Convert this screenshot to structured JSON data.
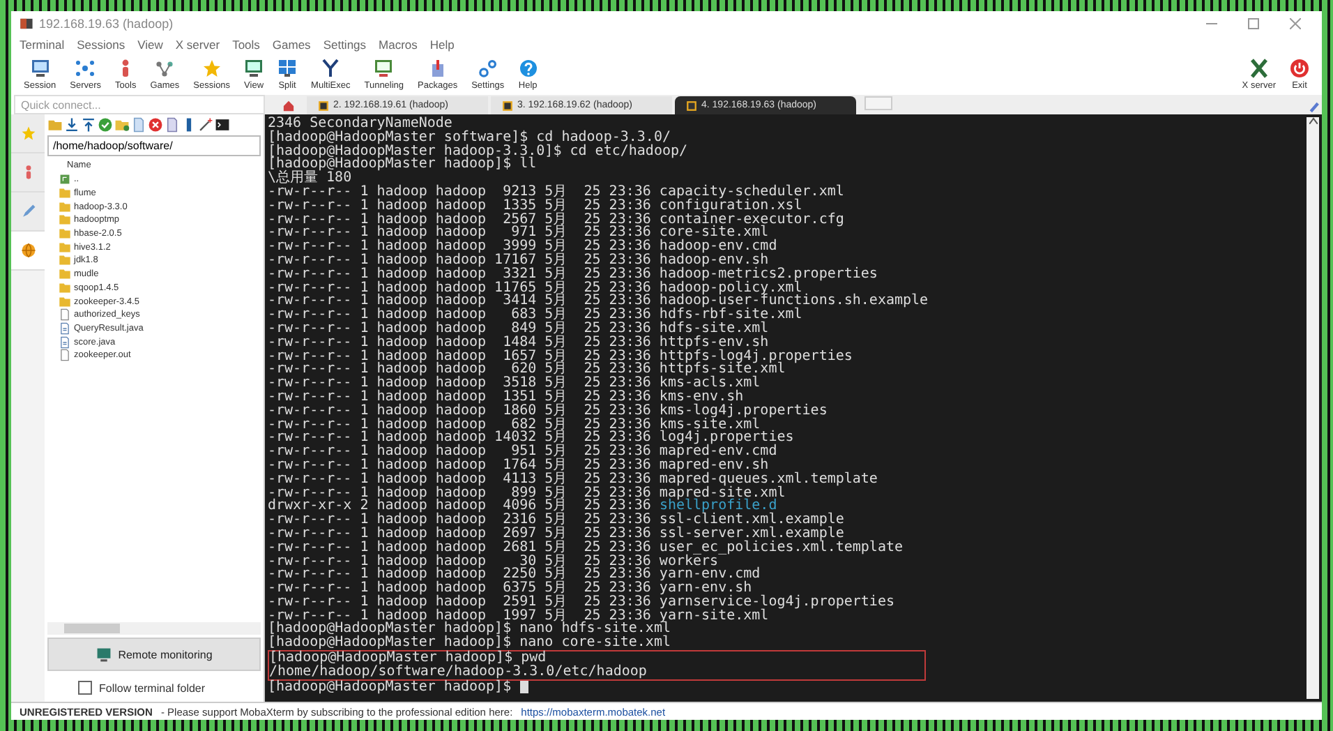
{
  "window": {
    "title": "192.168.19.63 (hadoop)"
  },
  "menu": [
    "Terminal",
    "Sessions",
    "View",
    "X server",
    "Tools",
    "Games",
    "Settings",
    "Macros",
    "Help"
  ],
  "toolbar": [
    "Session",
    "Servers",
    "Tools",
    "Games",
    "Sessions",
    "View",
    "Split",
    "MultiExec",
    "Tunneling",
    "Packages",
    "Settings",
    "Help"
  ],
  "toolbar_right": [
    "X server",
    "Exit"
  ],
  "quick_connect": {
    "placeholder": "Quick connect..."
  },
  "tabs": [
    {
      "label": "2. 192.168.19.61 (hadoop)",
      "selected": false
    },
    {
      "label": "3. 192.168.19.62 (hadoop)",
      "selected": false
    },
    {
      "label": "4. 192.168.19.63 (hadoop)",
      "selected": true
    }
  ],
  "side_tabs": [
    {
      "selected": false
    },
    {
      "selected": false
    },
    {
      "selected": false
    },
    {
      "selected": true
    }
  ],
  "sftp": {
    "path": "/home/hadoop/software/",
    "column": "Name",
    "items": [
      {
        "name": "..",
        "kind": "parent"
      },
      {
        "name": "flume",
        "kind": "folder"
      },
      {
        "name": "hadoop-3.3.0",
        "kind": "folder"
      },
      {
        "name": "hadooptmp",
        "kind": "folder"
      },
      {
        "name": "hbase-2.0.5",
        "kind": "folder"
      },
      {
        "name": "hive3.1.2",
        "kind": "folder"
      },
      {
        "name": "jdk1.8",
        "kind": "folder"
      },
      {
        "name": "mudle",
        "kind": "folder"
      },
      {
        "name": "sqoop1.4.5",
        "kind": "folder"
      },
      {
        "name": "zookeeper-3.4.5",
        "kind": "folder"
      },
      {
        "name": "authorized_keys",
        "kind": "file"
      },
      {
        "name": "QueryResult.java",
        "kind": "java"
      },
      {
        "name": "score.java",
        "kind": "java"
      },
      {
        "name": "zookeeper.out",
        "kind": "file"
      }
    ],
    "remote_monitoring": "Remote monitoring",
    "follow": {
      "label": "Follow terminal folder",
      "checked": false
    }
  },
  "terminal": {
    "lines": [
      {
        "text": "2346 SecondaryNameNode"
      },
      {
        "text": "[hadoop@HadoopMaster software]$ cd hadoop-3.3.0/"
      },
      {
        "text": "[hadoop@HadoopMaster hadoop-3.3.0]$ cd etc/hadoop/"
      },
      {
        "text": "[hadoop@HadoopMaster hadoop]$ ll"
      },
      {
        "text": "\\总用量 180"
      },
      {
        "text": "-rw-r--r-- 1 hadoop hadoop  9213 5月  25 23:36 capacity-scheduler.xml"
      },
      {
        "text": "-rw-r--r-- 1 hadoop hadoop  1335 5月  25 23:36 configuration.xsl"
      },
      {
        "text": "-rw-r--r-- 1 hadoop hadoop  2567 5月  25 23:36 container-executor.cfg"
      },
      {
        "text": "-rw-r--r-- 1 hadoop hadoop   971 5月  25 23:36 core-site.xml"
      },
      {
        "text": "-rw-r--r-- 1 hadoop hadoop  3999 5月  25 23:36 hadoop-env.cmd"
      },
      {
        "text": "-rw-r--r-- 1 hadoop hadoop 17167 5月  25 23:36 hadoop-env.sh"
      },
      {
        "text": "-rw-r--r-- 1 hadoop hadoop  3321 5月  25 23:36 hadoop-metrics2.properties"
      },
      {
        "text": "-rw-r--r-- 1 hadoop hadoop 11765 5月  25 23:36 hadoop-policy.xml"
      },
      {
        "text": "-rw-r--r-- 1 hadoop hadoop  3414 5月  25 23:36 hadoop-user-functions.sh.example"
      },
      {
        "text": "-rw-r--r-- 1 hadoop hadoop   683 5月  25 23:36 hdfs-rbf-site.xml"
      },
      {
        "text": "-rw-r--r-- 1 hadoop hadoop   849 5月  25 23:36 hdfs-site.xml"
      },
      {
        "text": "-rw-r--r-- 1 hadoop hadoop  1484 5月  25 23:36 httpfs-env.sh"
      },
      {
        "text": "-rw-r--r-- 1 hadoop hadoop  1657 5月  25 23:36 httpfs-log4j.properties"
      },
      {
        "text": "-rw-r--r-- 1 hadoop hadoop   620 5月  25 23:36 httpfs-site.xml"
      },
      {
        "text": "-rw-r--r-- 1 hadoop hadoop  3518 5月  25 23:36 kms-acls.xml"
      },
      {
        "text": "-rw-r--r-- 1 hadoop hadoop  1351 5月  25 23:36 kms-env.sh"
      },
      {
        "text": "-rw-r--r-- 1 hadoop hadoop  1860 5月  25 23:36 kms-log4j.properties"
      },
      {
        "text": "-rw-r--r-- 1 hadoop hadoop   682 5月  25 23:36 kms-site.xml"
      },
      {
        "text": "-rw-r--r-- 1 hadoop hadoop 14032 5月  25 23:36 log4j.properties"
      },
      {
        "text": "-rw-r--r-- 1 hadoop hadoop   951 5月  25 23:36 mapred-env.cmd"
      },
      {
        "text": "-rw-r--r-- 1 hadoop hadoop  1764 5月  25 23:36 mapred-env.sh"
      },
      {
        "text": "-rw-r--r-- 1 hadoop hadoop  4113 5月  25 23:36 mapred-queues.xml.template"
      },
      {
        "text": "-rw-r--r-- 1 hadoop hadoop   899 5月  25 23:36 mapred-site.xml"
      },
      {
        "text": "drwxr-xr-x 2 hadoop hadoop  4096 5月  25 23:36 ",
        "dir": "shellprofile.d"
      },
      {
        "text": "-rw-r--r-- 1 hadoop hadoop  2316 5月  25 23:36 ssl-client.xml.example"
      },
      {
        "text": "-rw-r--r-- 1 hadoop hadoop  2697 5月  25 23:36 ssl-server.xml.example"
      },
      {
        "text": "-rw-r--r-- 1 hadoop hadoop  2681 5月  25 23:36 user_ec_policies.xml.template"
      },
      {
        "text": "-rw-r--r-- 1 hadoop hadoop    30 5月  25 23:36 workers"
      },
      {
        "text": "-rw-r--r-- 1 hadoop hadoop  2250 5月  25 23:36 yarn-env.cmd"
      },
      {
        "text": "-rw-r--r-- 1 hadoop hadoop  6375 5月  25 23:36 yarn-env.sh"
      },
      {
        "text": "-rw-r--r-- 1 hadoop hadoop  2591 5月  25 23:36 yarnservice-log4j.properties"
      },
      {
        "text": "-rw-r--r-- 1 hadoop hadoop  1997 5月  25 23:36 yarn-site.xml"
      },
      {
        "text": "[hadoop@HadoopMaster hadoop]$ nano hdfs-site.xml"
      },
      {
        "text": "[hadoop@HadoopMaster hadoop]$ nano core-site.xml"
      }
    ],
    "highlighted_lines": [
      {
        "text": "[hadoop@HadoopMaster hadoop]$ pwd"
      },
      {
        "text": "/home/hadoop/software/hadoop-3.3.0/etc/hadoop"
      }
    ],
    "prompt": {
      "text": "[hadoop@HadoopMaster hadoop]$ ",
      "cursor": true
    }
  },
  "status_bar": {
    "label": "UNREGISTERED VERSION",
    "message": "-  Please support MobaXterm by subscribing to the professional edition here:",
    "link": "https://mobaxterm.mobatek.net"
  }
}
